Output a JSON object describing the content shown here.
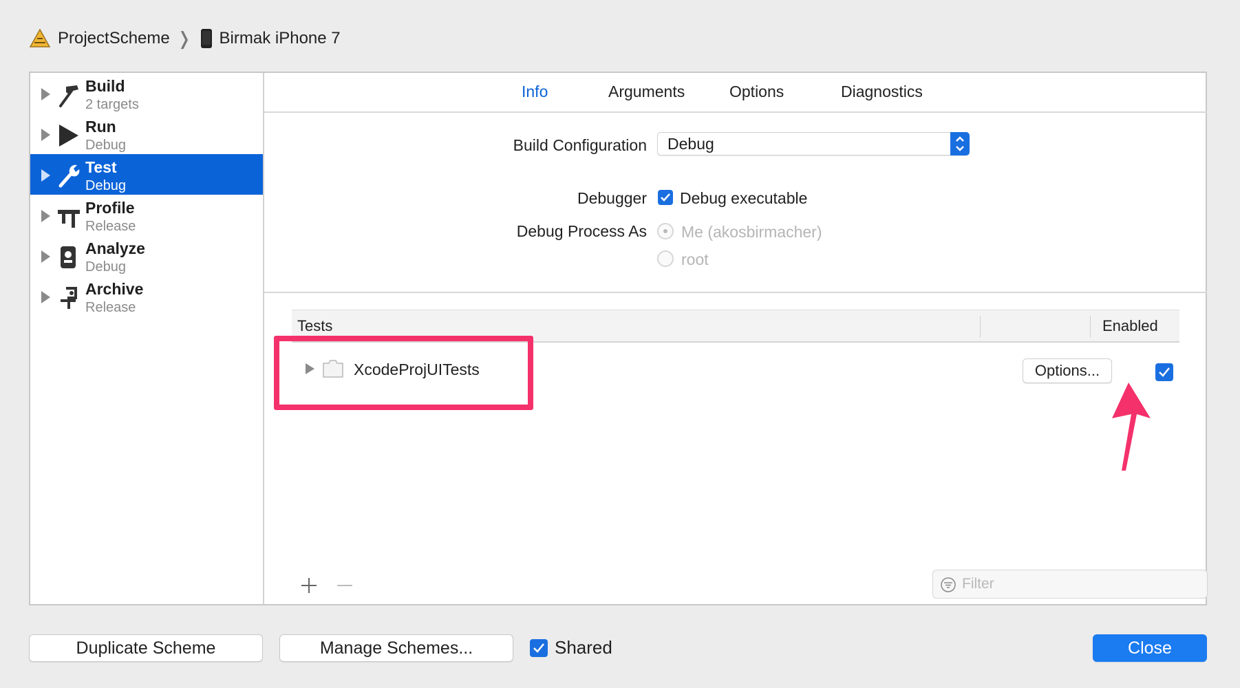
{
  "breadcrumb": {
    "scheme": "ProjectScheme",
    "device": "Birmak iPhone 7"
  },
  "sidebar": {
    "items": [
      {
        "title": "Build",
        "subtitle": "2 targets",
        "icon": "hammer-icon",
        "selected": false
      },
      {
        "title": "Run",
        "subtitle": "Debug",
        "icon": "play-icon",
        "selected": false
      },
      {
        "title": "Test",
        "subtitle": "Debug",
        "icon": "wrench-icon",
        "selected": true
      },
      {
        "title": "Profile",
        "subtitle": "Release",
        "icon": "caliper-icon",
        "selected": false
      },
      {
        "title": "Analyze",
        "subtitle": "Debug",
        "icon": "analyze-icon",
        "selected": false
      },
      {
        "title": "Archive",
        "subtitle": "Release",
        "icon": "archive-icon",
        "selected": false
      }
    ]
  },
  "tabs": [
    {
      "label": "Info",
      "active": true
    },
    {
      "label": "Arguments",
      "active": false
    },
    {
      "label": "Options",
      "active": false
    },
    {
      "label": "Diagnostics",
      "active": false
    }
  ],
  "info": {
    "build_config_label": "Build Configuration",
    "build_config_value": "Debug",
    "debugger_label": "Debugger",
    "debugger_checkbox_label": "Debug executable",
    "debugger_checked": true,
    "debug_process_label": "Debug Process As",
    "debug_process_options": [
      "Me (akosbirmacher)",
      "root"
    ],
    "debug_process_selected": 0
  },
  "tests": {
    "columns": [
      "Tests",
      "Enabled"
    ],
    "rows": [
      {
        "name": "XcodeProjUITests",
        "options_label": "Options...",
        "enabled": true
      }
    ],
    "filter_placeholder": "Filter"
  },
  "footer": {
    "duplicate_label": "Duplicate Scheme",
    "manage_label": "Manage Schemes...",
    "shared_label": "Shared",
    "shared_checked": true,
    "close_label": "Close"
  },
  "colors": {
    "accent": "#1a6fe0",
    "selection": "#0b63d8",
    "annotation": "#f4316b"
  }
}
